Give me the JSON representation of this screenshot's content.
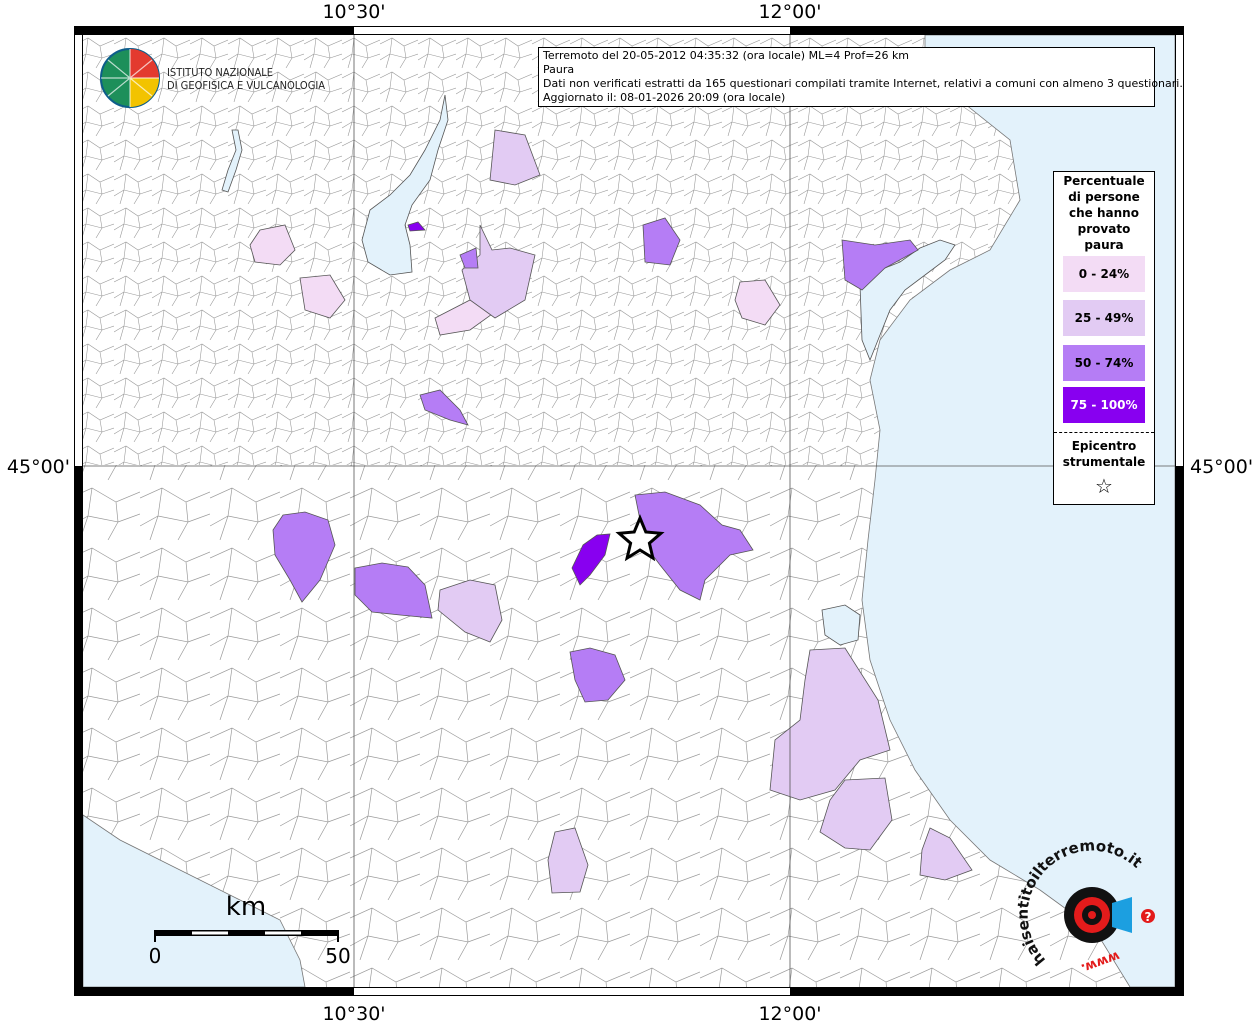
{
  "header": {
    "title": "Terremoto del 20-05-2012 04:35:32 (ora locale) ML=4 Prof=26 km",
    "subtitle": "Paura",
    "note": "Dati non verificati estratti da 165 questionari compilati tramite Internet, relativi a comuni con almeno 3 questionari.",
    "updated": "Aggiornato il: 08-01-2026 20:09 (ora locale)"
  },
  "axes": {
    "top_left": "10°30'",
    "top_right": "12°00'",
    "bottom_left": "10°30'",
    "bottom_right": "12°00'",
    "left_lat": "45°00'",
    "right_lat": "45°00'"
  },
  "logo": {
    "line1": "ISTITUTO NAZIONALE",
    "line2": "DI GEOFISICA E VULCANOLOGIA"
  },
  "legend": {
    "title": "Percentuale di persone che hanno provato paura",
    "items": [
      {
        "label": "0 - 24%",
        "color": "#f3dcf5"
      },
      {
        "label": "25 - 49%",
        "color": "#e2cbf3"
      },
      {
        "label": "50 - 74%",
        "color": "#b57df5"
      },
      {
        "label": "75 - 100%",
        "color": "#8800f0"
      }
    ],
    "epicenter_label": "Epicentro strumentale",
    "star": "☆"
  },
  "scale": {
    "unit": "km",
    "min": "0",
    "max": "50"
  },
  "watermark": {
    "text": "haisentitoilterremoto.it",
    "url": "www.",
    "question": "?"
  },
  "colors": {
    "water": "#e3f2fb",
    "boundary": "#8a8a8a"
  }
}
